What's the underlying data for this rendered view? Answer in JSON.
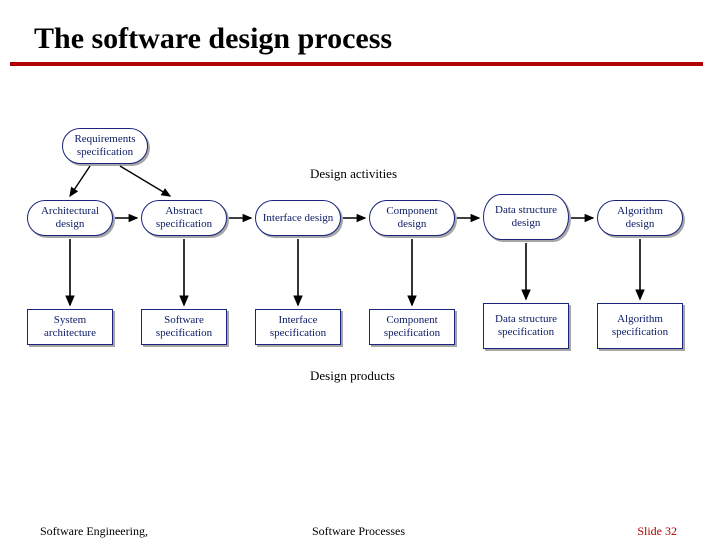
{
  "title": "The software design process",
  "captions": {
    "activities": "Design activities",
    "products": "Design products"
  },
  "input_node": "Requirements specification",
  "activities": [
    "Architectural design",
    "Abstract specification",
    "Interface design",
    "Component design",
    "Data structure design",
    "Algorithm design"
  ],
  "products": [
    "System architecture",
    "Software specification",
    "Interface specification",
    "Component specification",
    "Data structure specification",
    "Algorithm specification"
  ],
  "footer": {
    "left": "Software Engineering,",
    "center": "Software Processes",
    "right": "Slide 32"
  }
}
